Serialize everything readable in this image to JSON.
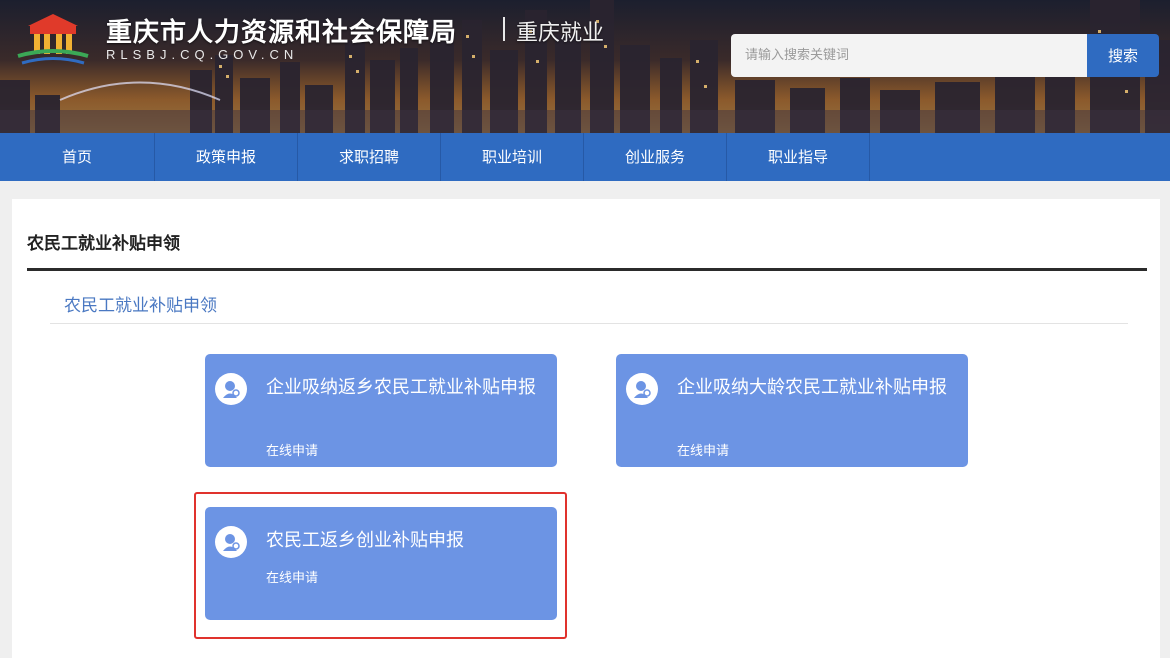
{
  "header": {
    "title": "重庆市人力资源和社会保障局",
    "subtitle": "重庆就业",
    "domain": "RLSBJ.CQ.GOV.CN",
    "search_placeholder": "请输入搜索关键词",
    "search_button": "搜索"
  },
  "nav": {
    "items": [
      {
        "label": "首页"
      },
      {
        "label": "政策申报"
      },
      {
        "label": "求职招聘"
      },
      {
        "label": "职业培训"
      },
      {
        "label": "创业服务"
      },
      {
        "label": "职业指导"
      }
    ]
  },
  "main": {
    "section_title": "农民工就业补贴申领",
    "sub_link": "农民工就业补贴申领",
    "cards": [
      {
        "title": "企业吸纳返乡农民工就业补贴申报",
        "action": "在线申请"
      },
      {
        "title": "企业吸纳大龄农民工就业补贴申报",
        "action": "在线申请"
      },
      {
        "title": "农民工返乡创业补贴申报",
        "action": "在线申请"
      }
    ]
  },
  "colors": {
    "nav_blue": "#2f6bc1",
    "card_blue": "#6c94e4",
    "highlight_red": "#e0322d"
  }
}
